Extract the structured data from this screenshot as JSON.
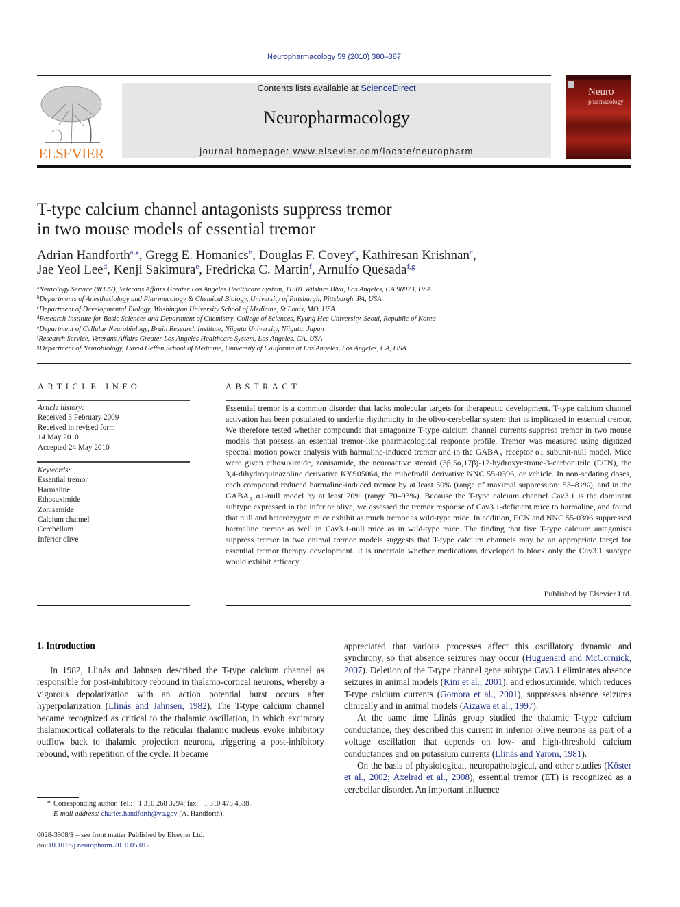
{
  "header": {
    "journal_ref": "Neuropharmacology 59 (2010) 380–387",
    "contents_prefix": "Contents lists available at ",
    "contents_link": "ScienceDirect",
    "journal_name": "Neuropharmacology",
    "homepage": "journal homepage: www.elsevier.com/locate/neuropharm",
    "publisher_logo": "ELSEVIER",
    "cover_title_1": "Neuro",
    "cover_title_2": "pharmacology",
    "colors": {
      "logo_orange": "#e87722",
      "link_blue": "#1f2f8a",
      "masthead_gray": "#e6e6e6",
      "cover_red": "#b3281c"
    }
  },
  "article": {
    "title_line1": "T-type calcium channel antagonists suppress tremor",
    "title_line2": "in two mouse models of essential tremor",
    "authors": [
      {
        "name": "Adrian Handforth",
        "sup": "a,⁎",
        "sep": ", "
      },
      {
        "name": "Gregg E. Homanics",
        "sup": "b",
        "sep": ", "
      },
      {
        "name": "Douglas F. Covey",
        "sup": "c",
        "sep": ", "
      },
      {
        "name": "Kathiresan Krishnan",
        "sup": "c",
        "sep": ","
      },
      {
        "name": "Jae Yeol Lee",
        "sup": "d",
        "sep": ", "
      },
      {
        "name": "Kenji Sakimura",
        "sup": "e",
        "sep": ", "
      },
      {
        "name": "Fredricka C. Martin",
        "sup": "f",
        "sep": ", "
      },
      {
        "name": "Arnulfo Quesada",
        "sup": "f,g",
        "sep": ""
      }
    ],
    "affiliations": [
      {
        "key": "a",
        "text": "Neurology Service (W127), Veterans Affairs Greater Los Angeles Healthcare System, 11301 Wilshire Blvd, Los Angeles, CA 90073, USA"
      },
      {
        "key": "b",
        "text": "Departments of Anesthesiology and Pharmacology & Chemical Biology, University of Pittsburgh, Pittsburgh, PA, USA"
      },
      {
        "key": "c",
        "text": "Department of Developmental Biology, Washington University School of Medicine, St Louis, MO, USA"
      },
      {
        "key": "d",
        "text": "Research Institute for Basic Sciences and Department of Chemistry, College of Sciences, Kyung Hee University, Seoul, Republic of Korea"
      },
      {
        "key": "e",
        "text": "Department of Cellular Neurobiology, Brain Research Institute, Niigata University, Niigata, Japan"
      },
      {
        "key": "f",
        "text": "Research Service, Veterans Affairs Greater Los Angeles Healthcare System, Los Angeles, CA, USA"
      },
      {
        "key": "g",
        "text": "Department of Neurobiology, David Geffen School of Medicine, University of California at Los Angeles, Los Angeles, CA, USA"
      }
    ]
  },
  "article_info": {
    "heading": "ARTICLE INFO",
    "history_label": "Article history:",
    "history": [
      "Received 3 February 2009",
      "Received in revised form",
      "14 May 2010",
      "Accepted 24 May 2010"
    ],
    "keywords_label": "Keywords:",
    "keywords": [
      "Essential tremor",
      "Harmaline",
      "Ethosuximide",
      "Zonisamide",
      "Calcium channel",
      "Cerebellum",
      "Inferior olive"
    ]
  },
  "abstract": {
    "heading": "ABSTRACT",
    "part1": "Essential tremor is a common disorder that lacks molecular targets for therapeutic development. T-type calcium channel activation has been postulated to underlie rhythmicity in the olivo-cerebellar system that is implicated in essential tremor. We therefore tested whether compounds that antagonize T-type calcium channel currents suppress tremor in two mouse models that possess an essential tremor-like pharmacological response profile. Tremor was measured using digitized spectral motion power analysis with harmaline-induced tremor and in the GABA",
    "sub1": "A",
    "part2": " receptor α1 subunit-null model. Mice were given ethosuximide, zonisamide, the neuroactive steroid (3β,5α,17β)-17-hydroxyestrane-3-carbonitrile (ECN), the 3,4-dihydroquinazoline derivative KYS05064, the mibefradil derivative NNC 55-0396, or vehicle. In non-sedating doses, each compound reduced harmaline-induced tremor by at least 50% (range of maximal suppression: 53–81%), and in the GABA",
    "sub2": "A",
    "part3": " α1-null model by at least 70% (range 70–93%). Because the T-type calcium channel Cav3.1 is the dominant subtype expressed in the inferior olive, we assessed the tremor response of Cav3.1-deficient mice to harmaline, and found that null and heterozygote mice exhibit as much tremor as wild-type mice. In addition, ECN and NNC 55-0396 suppressed harmaline tremor as well in Cav3.1-null mice as in wild-type mice. The finding that five T-type calcium antagonists suppress tremor in two animal tremor models suggests that T-type calcium channels may be an appropriate target for essential tremor therapy development. It is uncertain whether medications developed to block only the Cav3.1 subtype would exhibit efficacy.",
    "publisher": "Published by Elsevier Ltd."
  },
  "body": {
    "section_heading": "1.  Introduction",
    "left_p1_a": "In 1982, Llinás and Jahnsen described the T-type calcium channel as responsible for post-inhibitory rebound in thalamo-cortical neurons, whereby a vigorous depolarization with an action potential burst occurs after hyperpolarization (",
    "left_p1_ref1": "Llinás and Jahnsen, 1982",
    "left_p1_b": "). The T-type calcium channel became recognized as critical to the thalamic oscillation, in which excitatory thalamocortical collaterals to the reticular thalamic nucleus evoke inhibitory outflow back to thalamic projection neurons, triggering a post-inhibitory rebound, with repetition of the cycle. It became",
    "right_p1_a": "appreciated that various processes affect this oscillatory dynamic and synchrony, so that absence seizures may occur (",
    "right_p1_ref1": "Huguenard and McCormick, 2007",
    "right_p1_b": "). Deletion of the T-type channel gene subtype Cav3.1 eliminates absence seizures in animal models (",
    "right_p1_ref2": "Kim et al., 2001",
    "right_p1_c": "); and ethosuximide, which reduces T-type calcium currents (",
    "right_p1_ref3": "Gomora et al., 2001",
    "right_p1_d": "), suppresses absence seizures clinically and in animal models (",
    "right_p1_ref4": "Aizawa et al., 1997",
    "right_p1_e": ").",
    "right_p2_a": "At the same time Llinás' group studied the thalamic T-type calcium conductance, they described this current in inferior olive neurons as part of a voltage oscillation that depends on low- and high-threshold calcium conductances and on potassium currents (",
    "right_p2_ref1": "Llinás and Yarom, 1981",
    "right_p2_b": ").",
    "right_p3_a": "On the basis of physiological, neuropathological, and other studies (",
    "right_p3_ref1": "Köster et al., 2002; Axelrad et al., 2008",
    "right_p3_b": "), essential tremor (ET) is recognized as a cerebellar disorder. An important influence"
  },
  "footnotes": {
    "star": "*",
    "corresponding": "Corresponding author. Tel.: +1 310 268 3294; fax: +1 310 478 4538.",
    "email_label": "E-mail address:",
    "email": "charles.handforth@va.gov",
    "email_suffix": " (A. Handforth).",
    "frontmatter": "0028-3908/$ – see front matter Published by Elsevier Ltd.",
    "doi_prefix": "doi:",
    "doi": "10.1016/j.neuropharm.2010.05.012"
  }
}
